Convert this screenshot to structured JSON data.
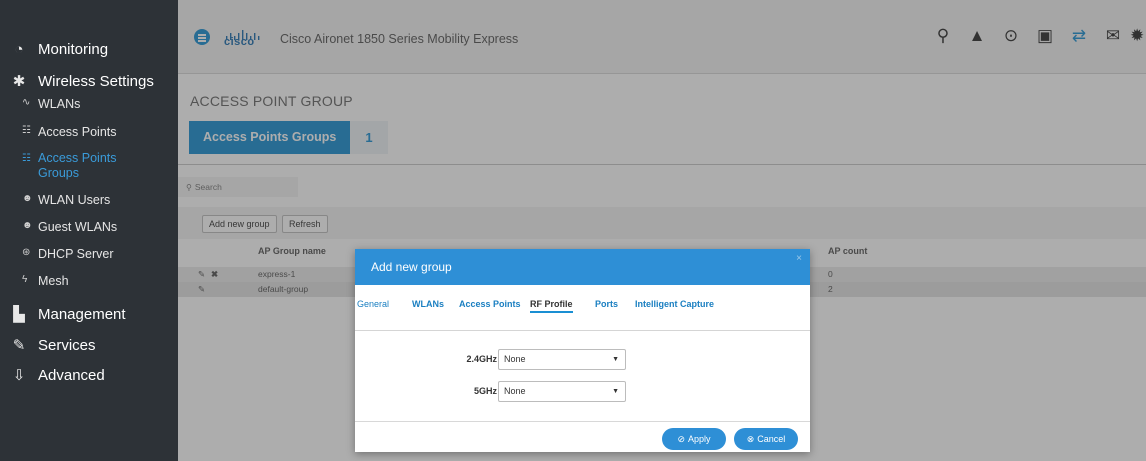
{
  "sidebar": {
    "main_items": [
      {
        "label": "Monitoring",
        "icon": "dashboard-icon",
        "glyph": "◔"
      },
      {
        "label": "Wireless Settings",
        "icon": "gear-icon",
        "glyph": "✱"
      },
      {
        "label": "Management",
        "icon": "management-icon",
        "glyph": "▙"
      },
      {
        "label": "Services",
        "icon": "wrench-icon",
        "glyph": "✎"
      },
      {
        "label": "Advanced",
        "icon": "download-tray-icon",
        "glyph": "⇩"
      }
    ],
    "sub_items": [
      {
        "label": "WLANs",
        "icon": "wifi-icon",
        "glyph": "∿",
        "active": false
      },
      {
        "label": "Access Points",
        "icon": "access-point-icon",
        "glyph": "☷",
        "active": false
      },
      {
        "label": "Access Points Groups",
        "icon": "access-point-icon",
        "glyph": "☷",
        "active": true
      },
      {
        "label": "WLAN Users",
        "icon": "users-icon",
        "glyph": "☻",
        "active": false
      },
      {
        "label": "Guest WLANs",
        "icon": "users-icon",
        "glyph": "☻",
        "active": false
      },
      {
        "label": "DHCP Server",
        "icon": "dhcp-icon",
        "glyph": "⊛",
        "active": false
      },
      {
        "label": "Mesh",
        "icon": "mesh-icon",
        "glyph": "ϟ",
        "active": false
      }
    ]
  },
  "header": {
    "brand": "cisco",
    "title": "Cisco Aironet 1850 Series Mobility Express",
    "icons": [
      {
        "name": "search-icon",
        "glyph": "⚲"
      },
      {
        "name": "alert-icon",
        "glyph": "▲"
      },
      {
        "name": "download-icon",
        "glyph": "⊙"
      },
      {
        "name": "save-icon",
        "glyph": "▣"
      },
      {
        "name": "transfer-icon",
        "glyph": "⇄"
      },
      {
        "name": "mail-icon",
        "glyph": "✉"
      },
      {
        "name": "settings-icon",
        "glyph": "✹"
      }
    ]
  },
  "page": {
    "title": "ACCESS POINT GROUP",
    "tab_label": "Access Points Groups",
    "tab_count": "1",
    "search_placeholder": "Search",
    "add_button": "Add new group",
    "refresh_button": "Refresh"
  },
  "table": {
    "columns": [
      "AP Group name",
      "AP count"
    ],
    "rows": [
      {
        "name": "express-1",
        "count": "0"
      },
      {
        "name": "default-group",
        "count": "2"
      }
    ]
  },
  "modal": {
    "title": "Add new group",
    "close": "×",
    "tabs": [
      "General",
      "WLANs",
      "Access Points",
      "RF Profile",
      "Ports",
      "Intelligent Capture"
    ],
    "active_tab": "RF Profile",
    "fields": [
      {
        "label": "2.4GHz",
        "value": "None"
      },
      {
        "label": "5GHz",
        "value": "None"
      }
    ],
    "apply": "Apply",
    "cancel": "Cancel"
  },
  "colors": {
    "accent": "#1a8fd3",
    "sidebar_bg": "#2d3237",
    "modal_header": "#2e8fd6"
  }
}
